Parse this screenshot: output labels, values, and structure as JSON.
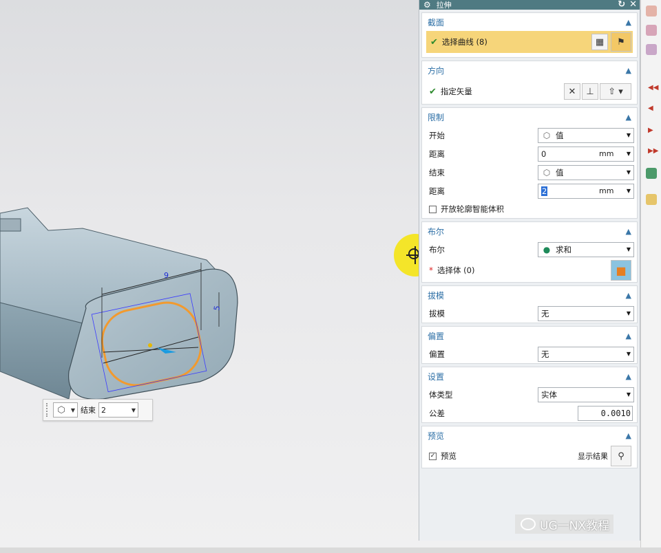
{
  "dialog": {
    "title": "拉伸",
    "sections": {
      "section": {
        "header": "截面",
        "select_curve_label": "选择曲线 (8)"
      },
      "direction": {
        "header": "方向",
        "specify_vector_label": "指定矢量"
      },
      "limits": {
        "header": "限制",
        "start_label": "开始",
        "start_value": "值",
        "start_distance_label": "距离",
        "start_distance_value": "0",
        "start_distance_unit": "mm",
        "end_label": "结束",
        "end_value": "值",
        "end_distance_label": "距离",
        "end_distance_value": "2",
        "end_distance_unit": "mm",
        "open_profile_label": "开放轮廓智能体积"
      },
      "boolean": {
        "header": "布尔",
        "boolean_label": "布尔",
        "boolean_value": "求和",
        "select_body_label": "选择体 (0)"
      },
      "draft": {
        "header": "拔模",
        "draft_label": "拔模",
        "draft_value": "无"
      },
      "offset": {
        "header": "偏置",
        "offset_label": "偏置",
        "offset_value": "无"
      },
      "settings": {
        "header": "设置",
        "body_type_label": "体类型",
        "body_type_value": "实体",
        "tolerance_label": "公差",
        "tolerance_value": "0.0010"
      },
      "preview": {
        "header": "预览",
        "preview_label": "预览",
        "show_result_label": "显示结果"
      }
    }
  },
  "viewport": {
    "mini_toolbar": {
      "label": "结束",
      "value": "2"
    },
    "dimension_labels": {
      "width": "9",
      "height": "5"
    }
  },
  "watermark": {
    "text": "UG一NX教程"
  },
  "colors": {
    "title_bar": "#4f7a82",
    "section_header": "#2d6fa6",
    "selection_highlight": "#f6d57a",
    "profile_curve": "#f29a2e",
    "cursor_highlight": "#f5e414"
  }
}
